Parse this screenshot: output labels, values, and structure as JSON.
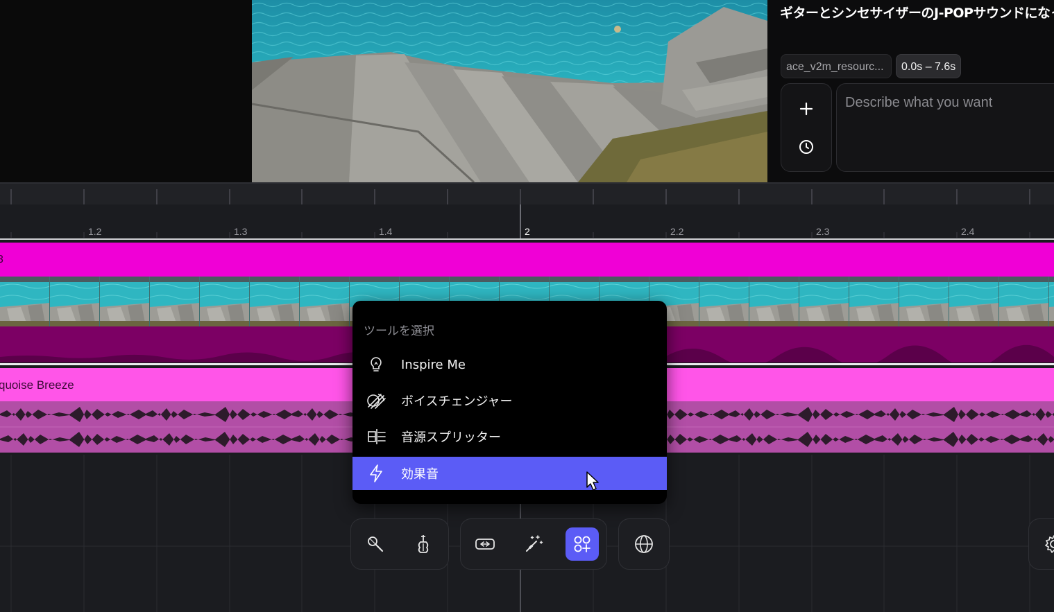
{
  "side_panel": {
    "prompt_text": "ギターとシンセサイザーのJ-POPサウンドになっていま",
    "resource_chip": "ace_v2m_resourc...",
    "range_chip": "0.0s – 7.6s",
    "describe_placeholder": "Describe what you want",
    "add_icon": "plus-icon",
    "history_icon": "clock-icon"
  },
  "timeline": {
    "ruler_labels": [
      "1.2",
      "1.3",
      "1.4",
      "2",
      "2.2",
      "2.3",
      "2.4"
    ],
    "video_track_label": "3",
    "music_track_label": "quoise Breeze"
  },
  "tool_menu": {
    "title": "ツールを選択",
    "items": [
      {
        "label": "Inspire Me",
        "icon": "lightbulb-icon"
      },
      {
        "label": "ボイスチェンジャー",
        "icon": "voice-changer-icon"
      },
      {
        "label": "音源スプリッター",
        "icon": "splitter-icon"
      },
      {
        "label": "効果音",
        "icon": "lightning-icon",
        "selected": true
      }
    ]
  },
  "toolbar": {
    "group1": [
      "microphone-icon",
      "violin-icon"
    ],
    "group2": [
      "swap-icon",
      "magic-wand-icon",
      "apps-add-icon"
    ],
    "group3": [
      "globe-icon"
    ],
    "settings_icon": "gear-icon",
    "accent_color": "#5b5cf6"
  },
  "colors": {
    "video_track": "#f000d6",
    "music_track": "#ff55e8",
    "selected_item": "#5b5cf6"
  }
}
